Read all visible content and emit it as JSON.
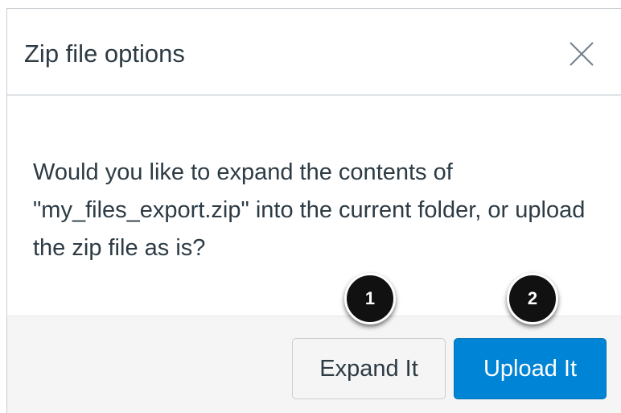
{
  "dialog": {
    "title": "Zip file options",
    "close_icon": "close-icon",
    "message": "Would you like to expand the contents of \"my_files_export.zip\" into the current folder, or upload the zip file as is?",
    "buttons": {
      "expand_label": "Expand It",
      "upload_label": "Upload It"
    }
  },
  "callouts": {
    "first": "1",
    "second": "2"
  },
  "colors": {
    "primary_button": "#0084d6",
    "text": "#2d3b45",
    "footer_background": "#f5f5f5",
    "callout": "#111111"
  }
}
